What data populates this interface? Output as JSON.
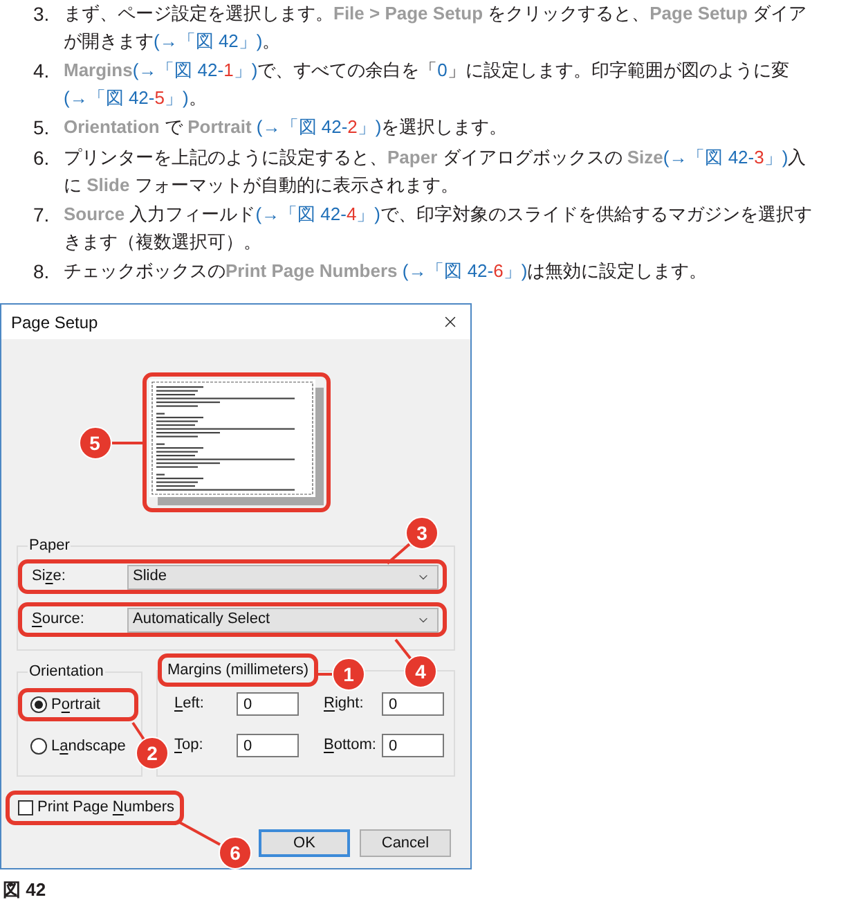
{
  "steps": [
    {
      "number": "3.",
      "lines": [
        [
          {
            "kind": "plain",
            "text": "まず、ページ設定を選択します。"
          },
          {
            "kind": "term",
            "text": "File > Page Setup"
          },
          {
            "kind": "plain",
            "text": " をクリックすると、"
          },
          {
            "kind": "term",
            "text": "Page Setup"
          },
          {
            "kind": "plain",
            "text": " ダイア"
          }
        ],
        [
          {
            "kind": "plain",
            "text": "が開きます"
          },
          {
            "kind": "ref",
            "text": "(→「図 42」)"
          },
          {
            "kind": "plain",
            "text": "。"
          }
        ]
      ]
    },
    {
      "number": "4.",
      "lines": [
        [
          {
            "kind": "term",
            "text": "Margins"
          },
          {
            "kind": "ref",
            "text": "(→「図 42-",
            "mark": "1",
            "end": "」)"
          },
          {
            "kind": "plain",
            "text": "で、すべての余白を「"
          },
          {
            "kind": "value",
            "text": "0"
          },
          {
            "kind": "plain",
            "text": "」に設定します。印字範囲が図のように変"
          }
        ],
        [
          {
            "kind": "ref",
            "text": "(→「図 42-",
            "mark": "5",
            "end": "」)"
          },
          {
            "kind": "plain",
            "text": "。"
          }
        ]
      ]
    },
    {
      "number": "5.",
      "lines": [
        [
          {
            "kind": "term",
            "text": "Orientation"
          },
          {
            "kind": "plain",
            "text": " で "
          },
          {
            "kind": "term",
            "text": "Portrait "
          },
          {
            "kind": "ref",
            "text": "(→「図 42-",
            "mark": "2",
            "end": "」)"
          },
          {
            "kind": "plain",
            "text": "を選択します。"
          }
        ]
      ]
    },
    {
      "number": "6.",
      "lines": [
        [
          {
            "kind": "plain",
            "text": "プリンターを上記のように設定すると、"
          },
          {
            "kind": "term",
            "text": "Paper"
          },
          {
            "kind": "plain",
            "text": " ダイアログボックスの "
          },
          {
            "kind": "term",
            "text": "Size"
          },
          {
            "kind": "ref",
            "text": "(→「図 42-",
            "mark": "3",
            "end": "」)"
          },
          {
            "kind": "plain",
            "text": "入"
          }
        ],
        [
          {
            "kind": "plain",
            "text": "に "
          },
          {
            "kind": "term",
            "text": "Slide"
          },
          {
            "kind": "plain",
            "text": " フォーマットが自動的に表示されます。"
          }
        ]
      ]
    },
    {
      "number": "7.",
      "lines": [
        [
          {
            "kind": "term",
            "text": "Source"
          },
          {
            "kind": "plain",
            "text": " 入力フィールド"
          },
          {
            "kind": "ref",
            "text": "(→「図 42-",
            "mark": "4",
            "end": "」)"
          },
          {
            "kind": "plain",
            "text": "で、印字対象のスライドを供給するマガジンを選択す"
          }
        ],
        [
          {
            "kind": "plain",
            "text": "きます（複数選択可）。"
          }
        ]
      ]
    },
    {
      "number": "8.",
      "lines": [
        [
          {
            "kind": "plain",
            "text": "チェックボックスの"
          },
          {
            "kind": "term",
            "text": "Print Page Numbers "
          },
          {
            "kind": "ref",
            "text": "(→「図 42-",
            "mark": "6",
            "end": "」)"
          },
          {
            "kind": "plain",
            "text": "は無効に設定します。"
          }
        ]
      ]
    }
  ],
  "dialog": {
    "title": "Page Setup",
    "preview": {
      "callout": "5"
    },
    "paper": {
      "label": "Paper",
      "fields": [
        {
          "label": {
            "before": "Si",
            "key": "z",
            "after": "e:"
          },
          "value": "Slide",
          "callout": "3"
        },
        {
          "label": {
            "key": "S",
            "after": "ource:"
          },
          "value": "Automatically Select",
          "callout": "4"
        }
      ]
    },
    "orientation": {
      "label": "Orientation",
      "options": [
        {
          "label": {
            "before": "P",
            "key": "o",
            "after": "rtrait"
          },
          "selected": true,
          "callout": "2"
        },
        {
          "label": {
            "before": "L",
            "key": "a",
            "after": "ndscape"
          },
          "selected": false
        }
      ]
    },
    "margins": {
      "label": "Margins (millimeters)",
      "callout": "1",
      "fields": [
        {
          "label": {
            "key": "L",
            "after": "eft:"
          },
          "value": "0"
        },
        {
          "label": {
            "key": "R",
            "after": "ight:"
          },
          "value": "0"
        },
        {
          "label": {
            "key": "T",
            "after": "op:"
          },
          "value": "0"
        },
        {
          "label": {
            "key": "B",
            "after": "ottom:"
          },
          "value": "0"
        }
      ]
    },
    "print_page_numbers": {
      "label": {
        "before": "Print Page ",
        "key": "N",
        "after": "umbers"
      },
      "checked": false,
      "callout": "6"
    },
    "buttons": [
      {
        "label": "OK",
        "default": true
      },
      {
        "label": "Cancel",
        "default": false
      }
    ]
  },
  "caption": "図 42"
}
